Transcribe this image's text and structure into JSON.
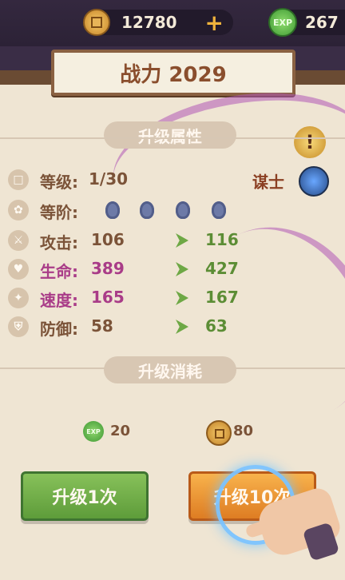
{
  "currency": {
    "coins": "12780",
    "exp": "267",
    "plus": "+"
  },
  "header": {
    "power": "战力 2029"
  },
  "sections": {
    "upgrade_attributes": "升级属性",
    "upgrade_cost": "升级消耗"
  },
  "stats": {
    "level_label": "等级:",
    "level_value": "1/30",
    "role": "谋士",
    "rank_label": "等阶:",
    "rows": [
      {
        "label": "攻击:",
        "current": "106",
        "next": "116"
      },
      {
        "label": "生命:",
        "current": "389",
        "next": "427"
      },
      {
        "label": "速度:",
        "current": "165",
        "next": "167"
      },
      {
        "label": "防御:",
        "current": "58",
        "next": "63"
      }
    ]
  },
  "costs": {
    "exp": "20",
    "coins": "80"
  },
  "buttons": {
    "upgrade_once": "升级1次",
    "upgrade_ten": "升级10次"
  },
  "icons": {
    "currency_coin": "coin-icon",
    "currency_exp": "exp-icon",
    "info": "warning-icon",
    "role": "role-icon"
  }
}
